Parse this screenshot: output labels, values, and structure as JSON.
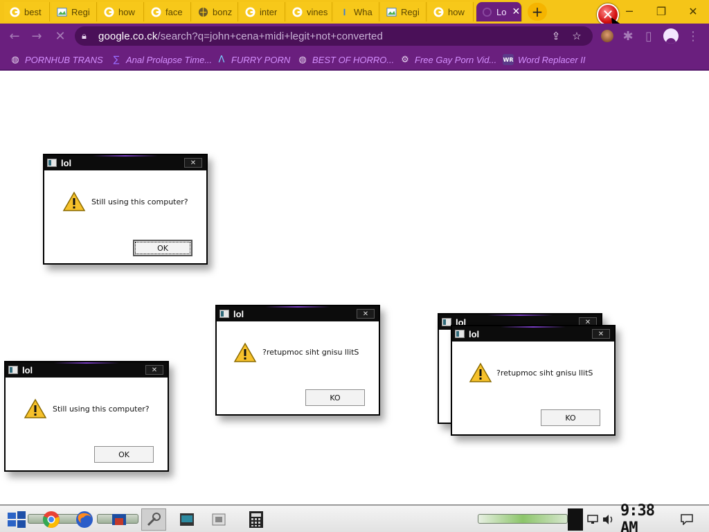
{
  "tabs": [
    {
      "title": "best",
      "favicon": "google-icon"
    },
    {
      "title": "Regi",
      "favicon": "image-icon"
    },
    {
      "title": "how",
      "favicon": "google-icon"
    },
    {
      "title": "face",
      "favicon": "google-icon"
    },
    {
      "title": "bonz",
      "favicon": "globe-icon"
    },
    {
      "title": "inter",
      "favicon": "google-icon"
    },
    {
      "title": "vines",
      "favicon": "google-icon"
    },
    {
      "title": "Wha",
      "favicon": "info-icon"
    },
    {
      "title": "Regi",
      "favicon": "image-icon"
    },
    {
      "title": "how",
      "favicon": "google-icon"
    },
    {
      "title": "Lo",
      "favicon": "loading-icon",
      "active": true
    }
  ],
  "window_controls": {
    "minimize": "─",
    "maximize": "❐",
    "close": "✕"
  },
  "address_bar": {
    "host": "google.co.ck",
    "path": "/search?q=john+cena+midi+legit+not+converted"
  },
  "bookmarks": [
    {
      "label": "PORNHUB TRANS",
      "icon": "globe-icon"
    },
    {
      "label": "Anal Prolapse Time...",
      "icon": "sigma-icon"
    },
    {
      "label": "FURRY PORN",
      "icon": "lambda-icon"
    },
    {
      "label": "BEST OF HORRO...",
      "icon": "globe-icon"
    },
    {
      "label": "Free Gay Porn Vid...",
      "icon": "gear-icon"
    },
    {
      "label": "Word Replacer II",
      "icon": "wr-icon"
    }
  ],
  "dialogs": [
    {
      "title": "lol",
      "message": "Still using this computer?",
      "button": "OK"
    },
    {
      "title": "lol",
      "message": "?retupmoc siht gnisu llitS",
      "button": "KO"
    },
    {
      "title": "lol",
      "message": "Still using this computer?",
      "button": "OK"
    },
    {
      "title": "lol",
      "message": "",
      "button": ""
    },
    {
      "title": "lol",
      "message": "?retupmoc siht gnisu llitS",
      "button": "KO"
    }
  ],
  "taskbar": {
    "clock": "9:38 AM"
  },
  "colors": {
    "tab_strip": "#f5c518",
    "browser_chrome": "#6a1f7e",
    "bookmark_text": "#d590ff"
  }
}
